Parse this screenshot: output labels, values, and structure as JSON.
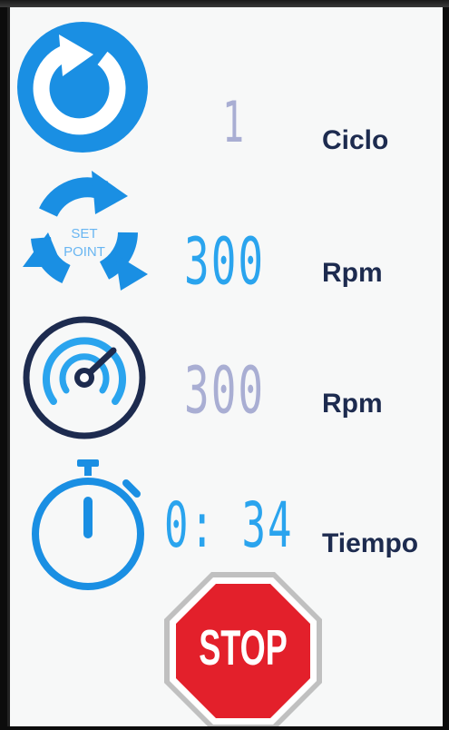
{
  "rows": [
    {
      "icon": "refresh-icon",
      "value": "1",
      "label": "Ciclo"
    },
    {
      "icon": "set-point-icon",
      "icon_text_top": "SET",
      "icon_text_bottom": "POINT",
      "value": "300",
      "label": "Rpm"
    },
    {
      "icon": "speedometer-icon",
      "value": "300",
      "label": "Rpm"
    },
    {
      "icon": "stopwatch-icon",
      "value": "0: 34",
      "label": "Tiempo"
    }
  ],
  "stop_button": {
    "label": "STOP"
  },
  "colors": {
    "accent_blue": "#1a8fe3",
    "value_grey": "#a9aed3",
    "value_blue": "#2aa4ee",
    "label_navy": "#1d2b4f",
    "stop_red": "#e3202b"
  }
}
